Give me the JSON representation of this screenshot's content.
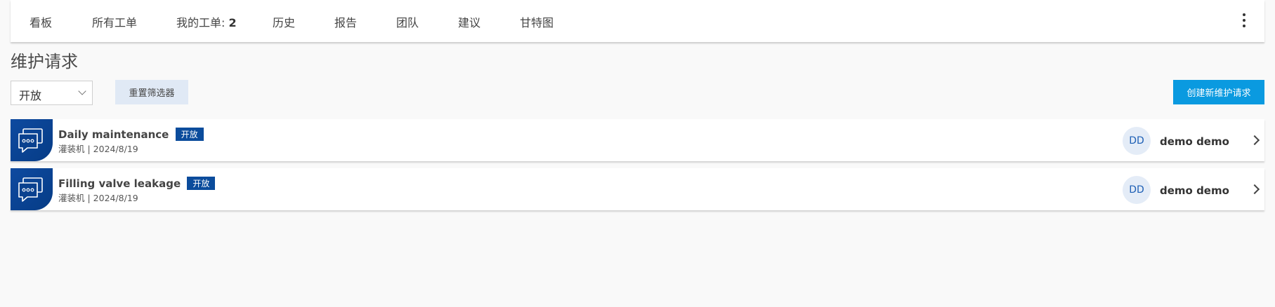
{
  "nav": {
    "tabs": [
      {
        "label": "看板"
      },
      {
        "label": "所有工单"
      },
      {
        "label": "我的工单: ",
        "count": "2"
      },
      {
        "label": "历史"
      },
      {
        "label": "报告"
      },
      {
        "label": "团队"
      },
      {
        "label": "建议"
      },
      {
        "label": "甘特图"
      }
    ],
    "more_icon": "vertical-ellipsis-icon"
  },
  "page": {
    "title": "维护请求"
  },
  "filters": {
    "status_value": "开放",
    "reset_label": "重置筛选器",
    "create_label": "创建新维护请求"
  },
  "requests": [
    {
      "icon": "chat-bubbles-icon",
      "title": "Daily maintenance",
      "badge": "开放",
      "subtitle": "灌装机 | 2024/8/19",
      "avatar": "DD",
      "assignee": "demo demo"
    },
    {
      "icon": "chat-bubbles-icon",
      "title": "Filling valve leakage",
      "badge": "开放",
      "subtitle": "灌装机 | 2024/8/19",
      "avatar": "DD",
      "assignee": "demo demo"
    }
  ],
  "colors": {
    "accent": "#0a9ae0",
    "badge": "#0b4c9c",
    "icon_bg": "#063c86",
    "reset_bg": "#e0e9f5"
  }
}
